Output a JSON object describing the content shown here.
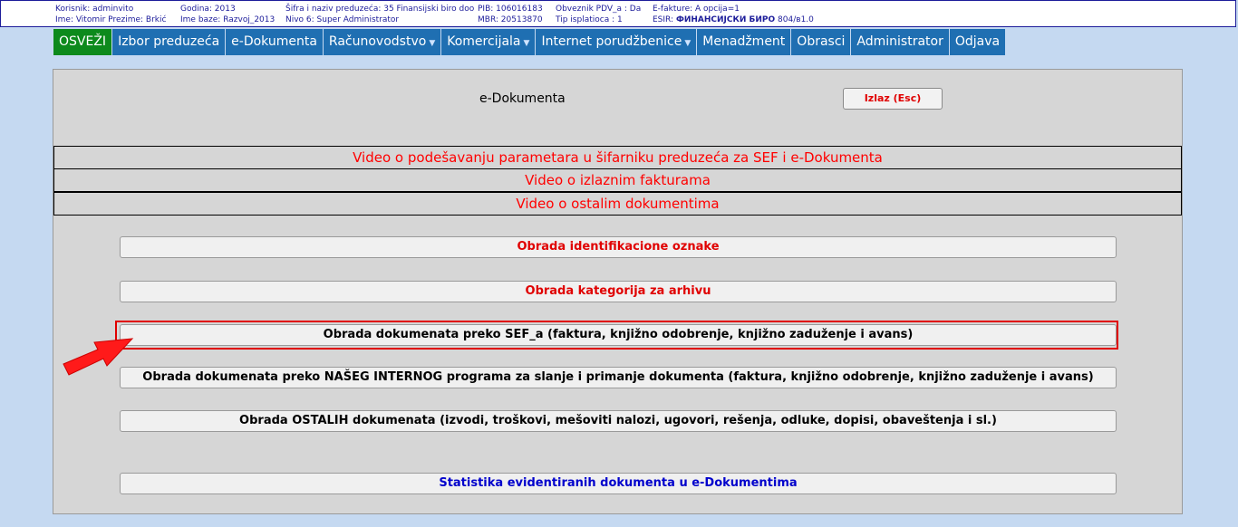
{
  "info": {
    "col1": [
      "Korisnik: adminvito",
      "Ime: Vitomir   Prezime: Brkić"
    ],
    "col2": [
      "Godina: 2013",
      "Ime baze: Razvoj_2013"
    ],
    "col3": [
      "Šifra i naziv preduzeća: 35 Finansijski biro doo",
      "Nivo 6: Super Administrator"
    ],
    "col4": [
      "PIB: 106016183",
      "MBR: 20513870"
    ],
    "col5": [
      "Obveznik PDV_a : Da",
      "Tip isplatioca : 1"
    ],
    "col6_line1": "E-fakture: A opcija=1",
    "esir_label": "ESIR: ",
    "esir_value": "ФИНАНСИЈСКИ БИРО",
    "esir_version": " 804/в1.0"
  },
  "menu": {
    "items": [
      {
        "label": "OSVEŽI"
      },
      {
        "label": "Izbor preduzeća"
      },
      {
        "label": "e-Dokumenta"
      },
      {
        "label": "Računovodstvo"
      },
      {
        "label": "Komercijala"
      },
      {
        "label": "Internet porudžbenice"
      },
      {
        "label": "Menadžment"
      },
      {
        "label": "Obrasci"
      },
      {
        "label": "Administrator"
      },
      {
        "label": "Odjava"
      }
    ]
  },
  "panel": {
    "title": "e-Dokumenta",
    "esc_label": "Izlaz (Esc)",
    "videos": [
      "Video o podešavanju parametara u šifarniku preduzeća za SEF i e-Dokumenta",
      "Video o izlaznim fakturama",
      "Video o ostalim dokumentima"
    ],
    "buttons": [
      "Obrada identifikacione oznake",
      "Obrada kategorija za arhivu",
      "Obrada dokumenata preko SEF_a (faktura, knjižno odobrenje, knjižno zaduženje i avans)",
      "Obrada dokumenata preko NAŠEG INTERNOG programa za slanje i primanje dokumenta (faktura, knjižno odobrenje, knjižno zaduženje i avans)",
      "Obrada OSTALIH dokumenata (izvodi, troškovi, mešoviti nalozi, ugovori, rešenja, odluke, dopisi, obaveštenja i sl.)",
      "Statistika evidentiranih dokumenta u e-Dokumentima"
    ]
  },
  "colors": {
    "menu_bg": "#1f6fb2",
    "menu_active": "#0d8a1c",
    "accent_red": "#e00000",
    "link_blue": "#0000cc"
  },
  "icons": {
    "dropdown": "caret-down-icon",
    "pointer": "red-arrow-icon"
  }
}
